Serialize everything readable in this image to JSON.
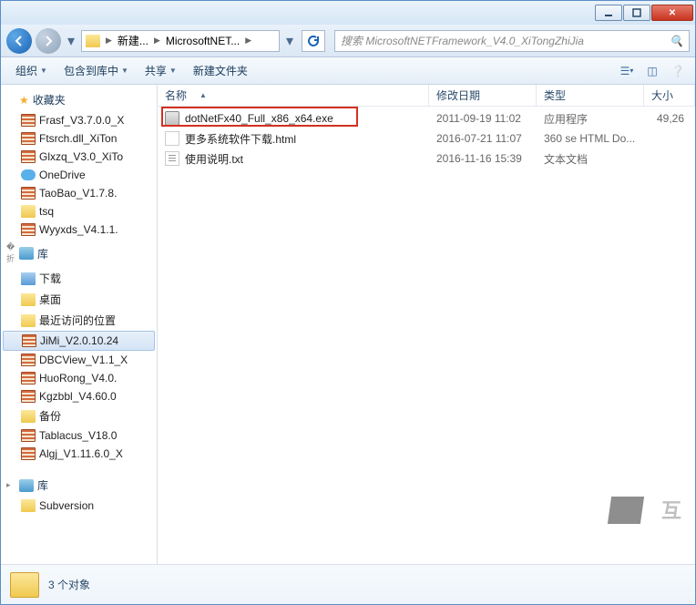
{
  "titlebar": {
    "min_tip": "最小化",
    "max_tip": "最大化",
    "close_tip": "关闭"
  },
  "breadcrumb": {
    "item1": "新建...",
    "item2": "MicrosoftNET..."
  },
  "search": {
    "placeholder": "搜索 MicrosoftNETFramework_V4.0_XiTongZhiJia"
  },
  "toolbar": {
    "organize": "组织",
    "include": "包含到库中",
    "share": "共享",
    "newfolder": "新建文件夹"
  },
  "columns": {
    "name": "名称",
    "date": "修改日期",
    "type": "类型",
    "size": "大小"
  },
  "sidebar": {
    "favorites_hdr": "收藏夹",
    "library_hdr": "库",
    "library_hdr2": "库",
    "items_fav": [
      {
        "label": "Frasf_V3.7.0.0_X",
        "icon": "archive"
      },
      {
        "label": "Ftsrch.dll_XiTon",
        "icon": "archive"
      },
      {
        "label": "Glxzq_V3.0_XiTo",
        "icon": "archive"
      },
      {
        "label": "OneDrive",
        "icon": "cloud"
      },
      {
        "label": "TaoBao_V1.7.8.",
        "icon": "archive"
      },
      {
        "label": "tsq",
        "icon": "folder"
      },
      {
        "label": "Wyyxds_V4.1.1.",
        "icon": "archive"
      }
    ],
    "items_lib": [
      {
        "label": "下载",
        "icon": "blue"
      },
      {
        "label": "桌面",
        "icon": "folder"
      },
      {
        "label": "最近访问的位置",
        "icon": "folder"
      },
      {
        "label": "JiMi_V2.0.10.24",
        "icon": "archive",
        "sel": true
      },
      {
        "label": "DBCView_V1.1_X",
        "icon": "archive"
      },
      {
        "label": "HuoRong_V4.0.",
        "icon": "archive"
      },
      {
        "label": "Kgzbbl_V4.60.0",
        "icon": "archive"
      },
      {
        "label": "备份",
        "icon": "folder"
      },
      {
        "label": "Tablacus_V18.0",
        "icon": "archive"
      },
      {
        "label": "Algj_V1.11.6.0_X",
        "icon": "archive"
      }
    ],
    "items_lib2": [
      {
        "label": "Subversion",
        "icon": "folder"
      }
    ]
  },
  "files": [
    {
      "name": "dotNetFx40_Full_x86_x64.exe",
      "date": "2011-09-19 11:02",
      "type": "应用程序",
      "size": "49,26",
      "icon": "exe",
      "highlight": true
    },
    {
      "name": "更多系统软件下载.html",
      "date": "2016-07-21 11:07",
      "type": "360 se HTML Do...",
      "size": "",
      "icon": "html"
    },
    {
      "name": "使用说明.txt",
      "date": "2016-11-16 15:39",
      "type": "文本文档",
      "size": "",
      "icon": "txt"
    }
  ],
  "status": {
    "count": "3 个对象"
  },
  "watermark": "互"
}
